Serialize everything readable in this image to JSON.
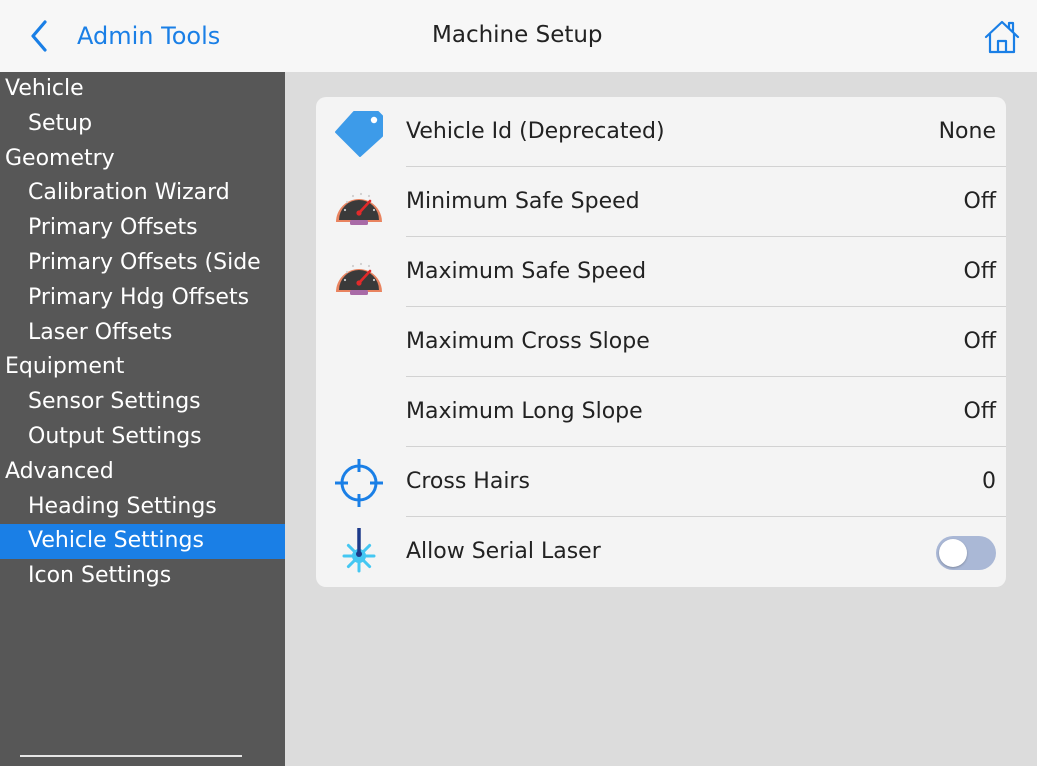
{
  "header": {
    "back_label": "Admin Tools",
    "title": "Machine Setup",
    "back_icon": "chevron-left-icon",
    "home_icon": "home-icon"
  },
  "sidebar": {
    "items": [
      {
        "label": "Vehicle",
        "kind": "section"
      },
      {
        "label": "Setup",
        "kind": "item"
      },
      {
        "label": "Geometry",
        "kind": "section"
      },
      {
        "label": "Calibration Wizard",
        "kind": "item"
      },
      {
        "label": "Primary Offsets",
        "kind": "item"
      },
      {
        "label": "Primary Offsets (Side",
        "kind": "item"
      },
      {
        "label": "Primary Hdg Offsets",
        "kind": "item"
      },
      {
        "label": "Laser Offsets",
        "kind": "item"
      },
      {
        "label": "Equipment",
        "kind": "section"
      },
      {
        "label": "Sensor Settings",
        "kind": "item"
      },
      {
        "label": "Output Settings",
        "kind": "item"
      },
      {
        "label": "Advanced",
        "kind": "section"
      },
      {
        "label": "Heading Settings",
        "kind": "item"
      },
      {
        "label": "Vehicle Settings",
        "kind": "item",
        "selected": true
      },
      {
        "label": "Icon Settings",
        "kind": "item"
      }
    ]
  },
  "settings": {
    "rows": [
      {
        "label": "Vehicle Id (Deprecated)",
        "value": "None",
        "icon": "tag-icon"
      },
      {
        "label": "Minimum Safe Speed",
        "value": "Off",
        "icon": "speedometer-icon"
      },
      {
        "label": "Maximum Safe Speed",
        "value": "Off",
        "icon": "speedometer-icon"
      },
      {
        "label": "Maximum Cross Slope",
        "value": "Off",
        "icon": ""
      },
      {
        "label": "Maximum Long Slope",
        "value": "Off",
        "icon": ""
      },
      {
        "label": "Cross Hairs",
        "value": "0",
        "icon": "crosshair-icon"
      },
      {
        "label": "Allow Serial Laser",
        "value": "",
        "icon": "laser-icon",
        "toggle": false
      }
    ]
  },
  "colors": {
    "accent": "#1a7fe6",
    "sidebar_bg": "#575757",
    "toggle_off": "#aab8d6",
    "tag": "#3d9be9",
    "gauge_ring": "#e9835f",
    "laser": "#44c7f2"
  }
}
